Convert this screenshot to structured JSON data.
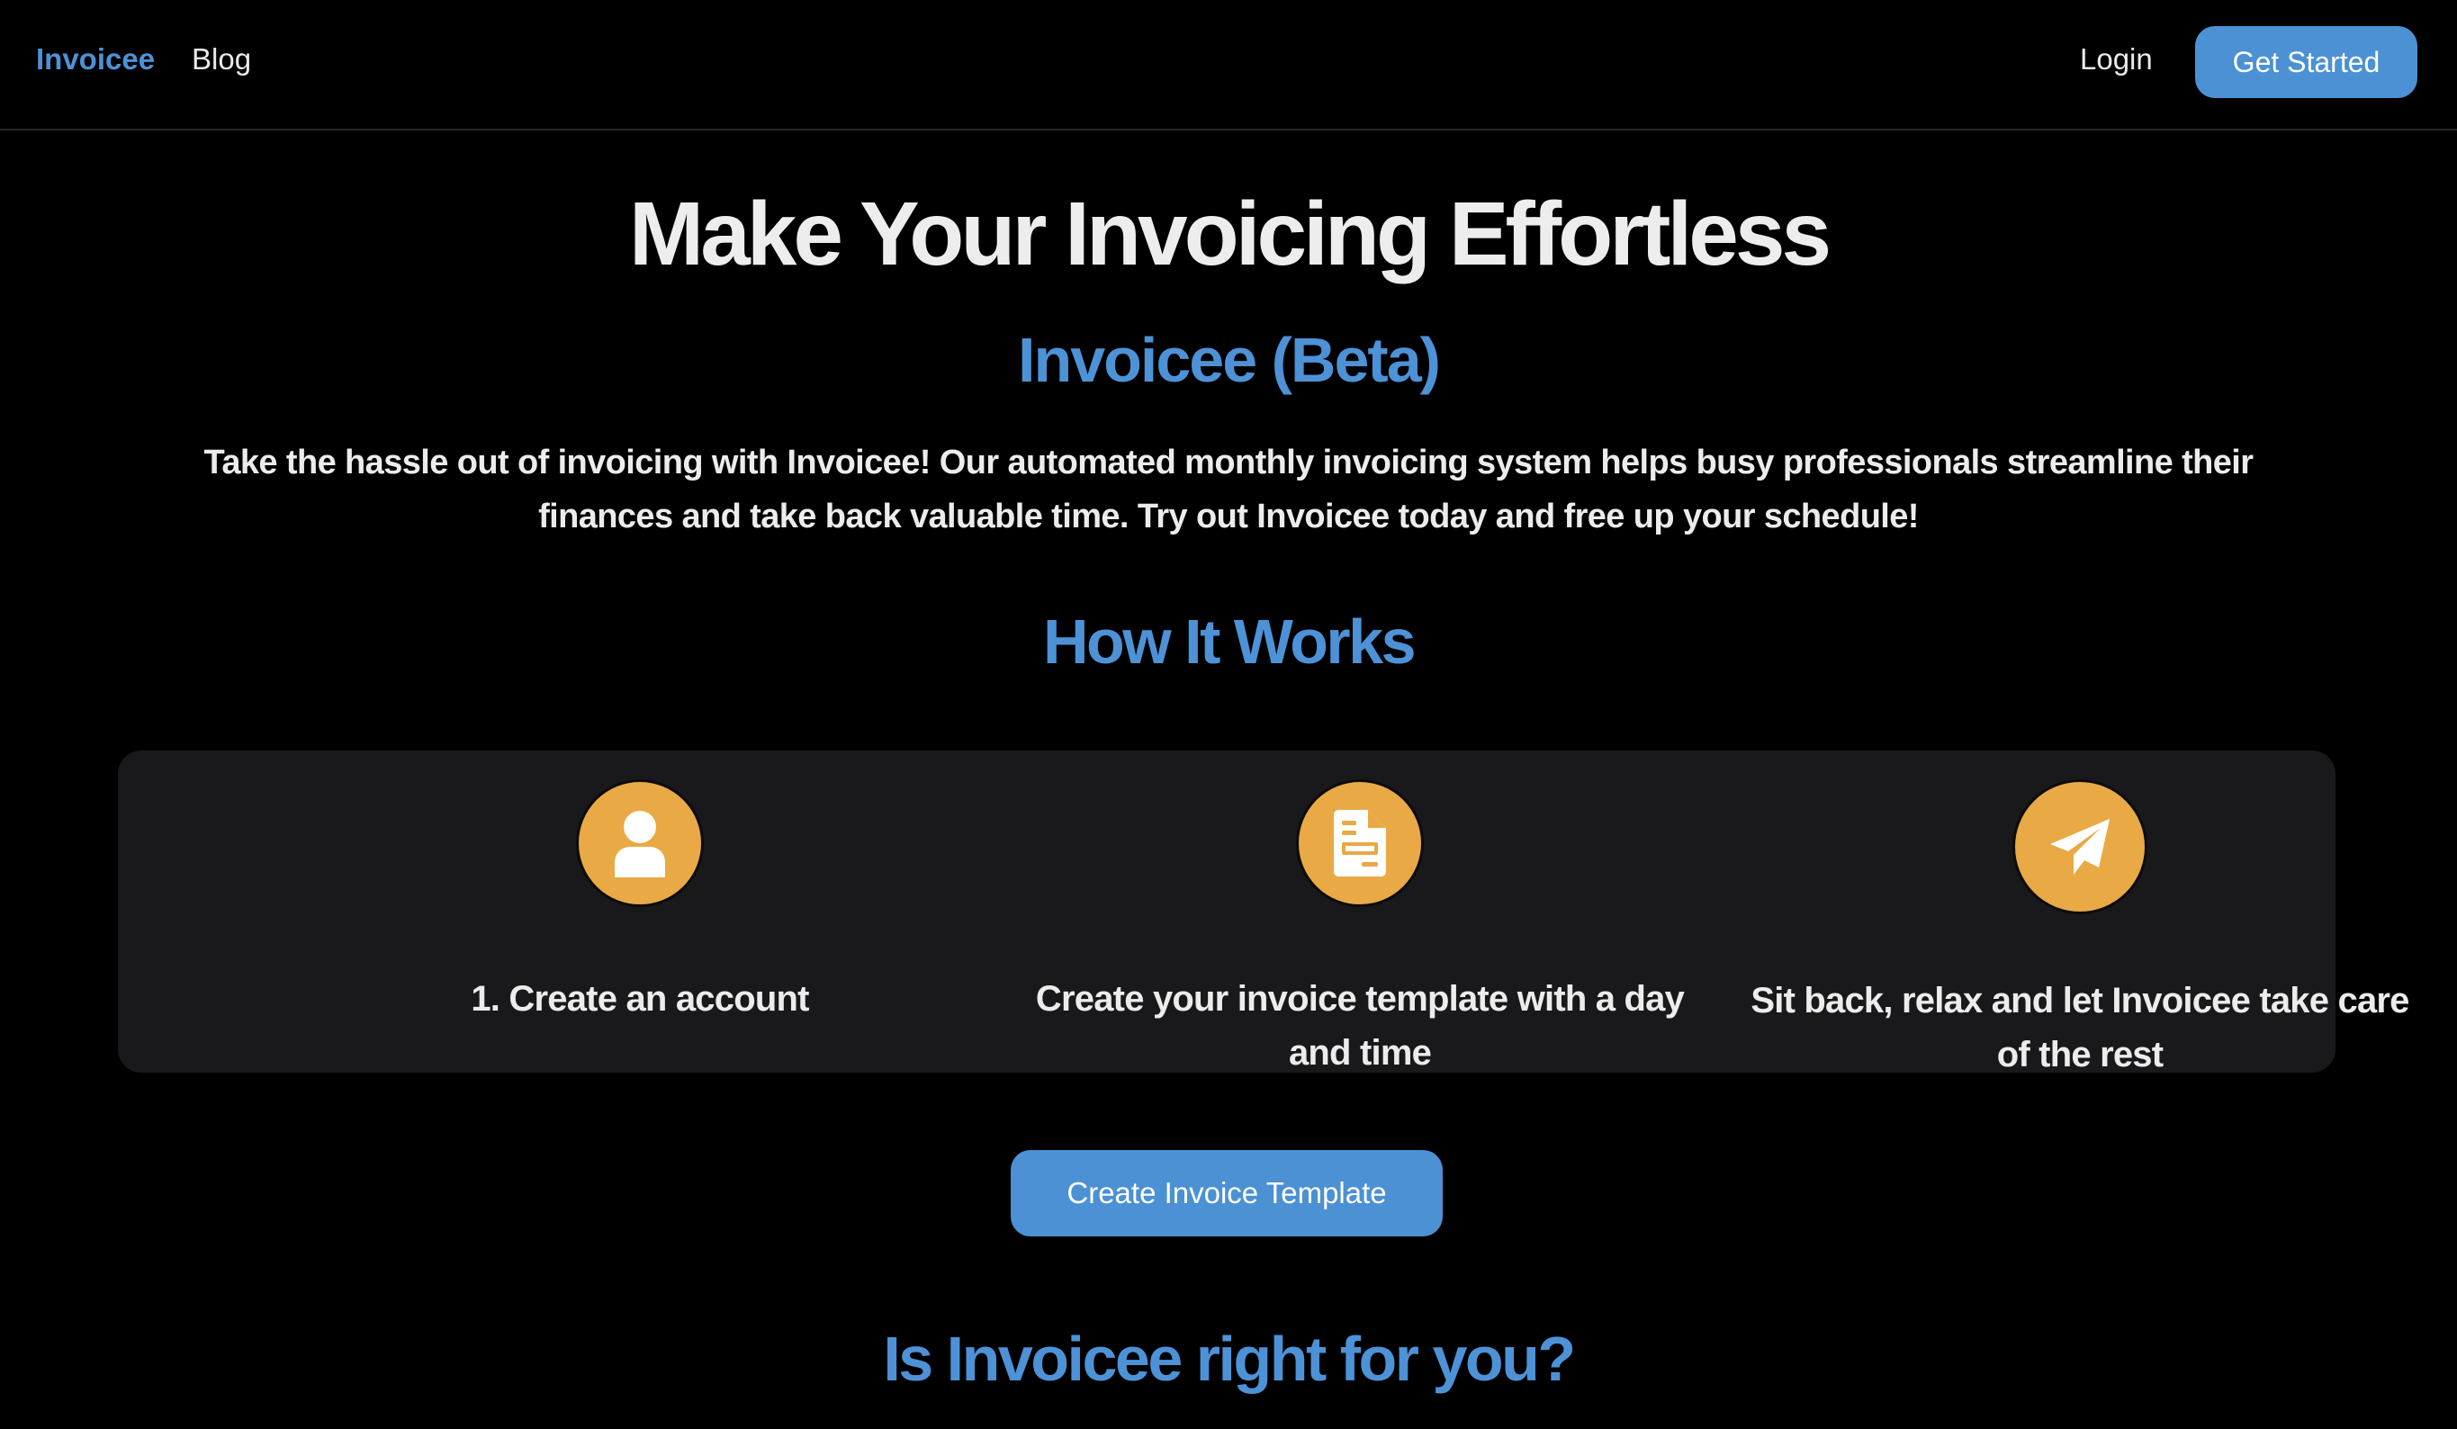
{
  "nav": {
    "brand": "Invoicee",
    "blog": "Blog",
    "login": "Login",
    "get_started": "Get Started"
  },
  "hero": {
    "title": "Make Your Invoicing Effortless",
    "subtitle": "Invoicee (Beta)",
    "description": "Take the hassle out of invoicing with Invoicee! Our automated monthly invoicing system helps busy professionals streamline their finances and take back valuable time. Try out Invoicee today and free up your schedule!"
  },
  "how_it_works": {
    "title": "How It Works",
    "steps": [
      {
        "icon": "user-icon",
        "label": "1. Create an account"
      },
      {
        "icon": "document-icon",
        "label": "Create your invoice template with a day and time"
      },
      {
        "icon": "paper-plane-icon",
        "label": "Sit back, relax and let Invoicee take care of the rest"
      }
    ]
  },
  "cta": {
    "create_template": "Create Invoice Template"
  },
  "fit_section": {
    "title": "Is Invoicee right for you?"
  },
  "colors": {
    "accent": "#4b91d3",
    "brand_text": "#4d92d6",
    "icon_circle": "#e9a945",
    "panel": "#19191b",
    "background": "#000000"
  }
}
